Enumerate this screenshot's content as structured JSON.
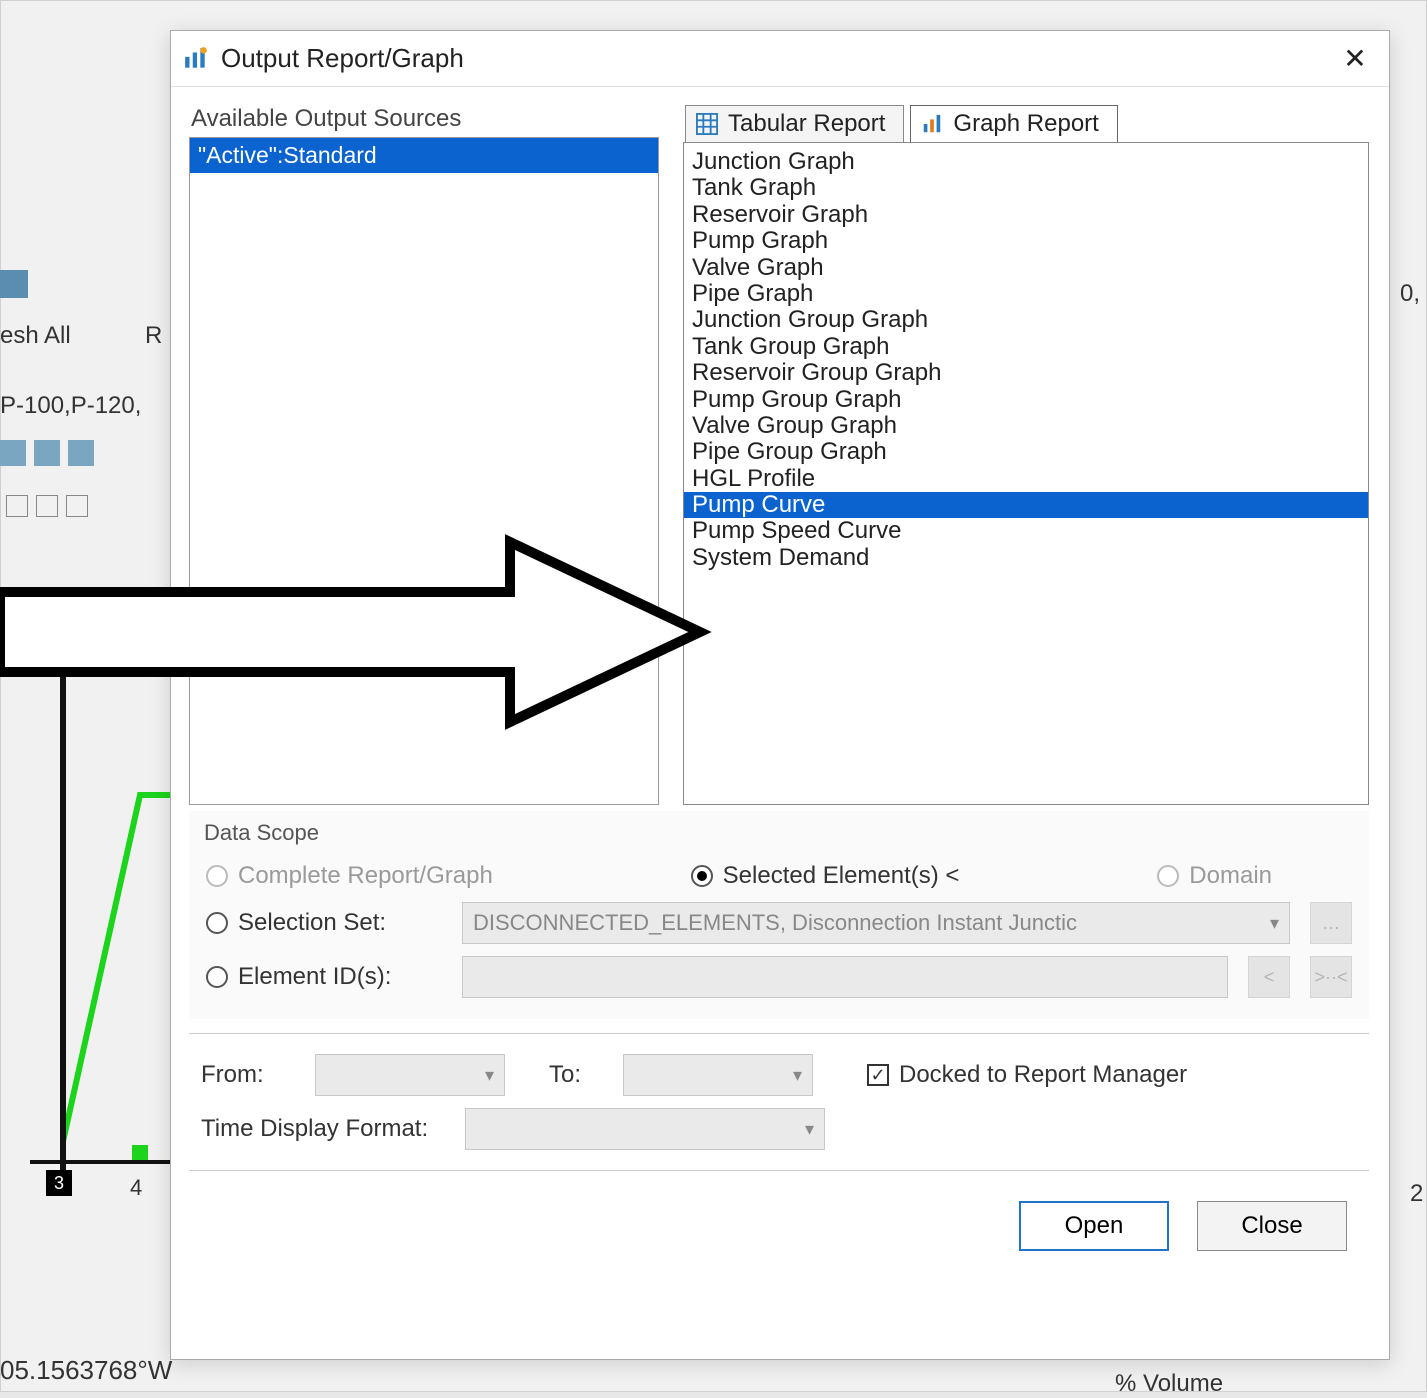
{
  "dialog": {
    "title": "Output Report/Graph",
    "sources_label": "Available Output Sources",
    "sources": {
      "selected": "\"Active\":Standard"
    },
    "tabs": {
      "tabular": "Tabular Report",
      "graph": "Graph Report",
      "active": "graph"
    },
    "graph_items": [
      "Junction Graph",
      "Tank Graph",
      "Reservoir Graph",
      "Pump Graph",
      "Valve Graph",
      "Pipe Graph",
      "Junction Group Graph",
      "Tank Group Graph",
      "Reservoir Group Graph",
      "Pump Group Graph",
      "Valve Group Graph",
      "Pipe Group Graph",
      "HGL Profile",
      "Pump Curve",
      "Pump Speed Curve",
      "System Demand"
    ],
    "graph_selected_index": 13,
    "data_scope": {
      "label": "Data Scope",
      "complete": "Complete Report/Graph",
      "selected_elements": "Selected Element(s) <",
      "domain": "Domain",
      "selection_set_label": "Selection Set:",
      "selection_set_value": "DISCONNECTED_ELEMENTS, Disconnection Instant Junctic",
      "element_ids_label": "Element ID(s):",
      "element_ids_value": ""
    },
    "time": {
      "from_label": "From:",
      "to_label": "To:",
      "from_value": "",
      "to_value": "",
      "docked_label": "Docked to Report Manager",
      "format_label": "Time Display Format:",
      "format_value": ""
    },
    "buttons": {
      "open": "Open",
      "close": "Close"
    }
  },
  "background": {
    "refresh_all": "esh All",
    "r_menu": "R",
    "pumps": "P-100,P-120,",
    "coord": "05.1563768°W",
    "x_tick_4": "4",
    "x_tick_3": "3",
    "right_num_0": "0,",
    "right_num_2": "2",
    "volume": "% Volume"
  }
}
